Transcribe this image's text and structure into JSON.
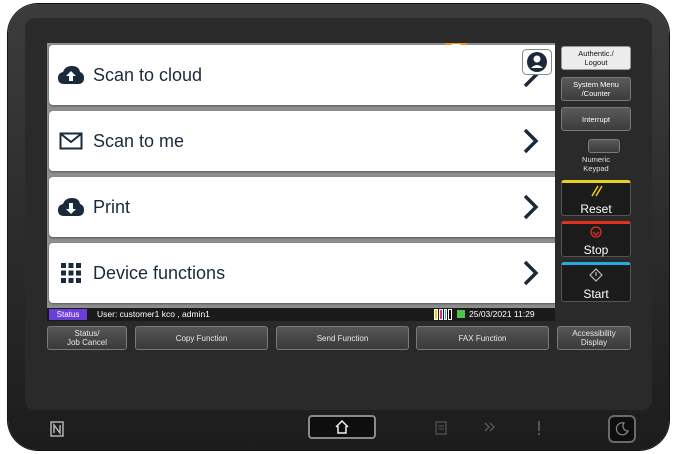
{
  "menu": {
    "tiles": [
      {
        "label": "Scan to cloud",
        "icon": "cloud-upload-icon"
      },
      {
        "label": "Scan to me",
        "icon": "envelope-icon"
      },
      {
        "label": "Print",
        "icon": "cloud-download-icon"
      },
      {
        "label": "Device functions",
        "icon": "grid-icon"
      }
    ]
  },
  "status_bar": {
    "status_label": "Status",
    "user_text": "User: customer1 kco , admin1",
    "datetime": "25/03/2021  11:29"
  },
  "function_tabs": {
    "status_job_cancel": "Status/\nJob Cancel",
    "copy": "Copy Function",
    "send": "Send Function",
    "fax": "FAX Function",
    "accessibility": "Accessibility\nDisplay"
  },
  "side_panel": {
    "auth_logout": "Authentic./\nLogout",
    "system_menu": "System Menu\n/Counter",
    "interrupt": "Interrupt",
    "numeric_keypad": "Numeric\nKeypad",
    "reset": "Reset",
    "stop": "Stop",
    "start": "Start"
  },
  "colors": {
    "status_chip": "#6a3ed8",
    "reset_accent": "#e8d020",
    "stop_accent": "#e03020",
    "start_accent": "#2aa8e0",
    "top_indicator": "#f0a000"
  }
}
